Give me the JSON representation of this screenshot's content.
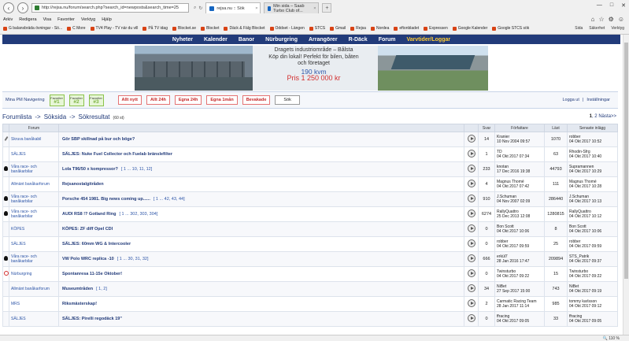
{
  "browser": {
    "url": "http://rejsa.nu/forum/search.php?search_id=newposts&search_time=25",
    "tabs": [
      {
        "title": "rejsa.nu :: Sök",
        "active": true
      },
      {
        "title": "Min sida – Saab Turbo Club of...",
        "active": false
      }
    ],
    "menu": [
      "Arkiv",
      "Redigera",
      "Visa",
      "Favoriter",
      "Verktyg",
      "Hjälp"
    ],
    "favorites": [
      "G balansbräda övningar - Sö...",
      "C More",
      "TV4 Play - TV när du vill",
      "På TV idag",
      "Blocket.se",
      "Blocket",
      "Däck & Fälg Blocket",
      "Oddset - Längen",
      "STCS",
      "Gmail",
      "Rejsa",
      "Nordea",
      "eftonbladet",
      "Expressen",
      "Google Kalender",
      "Google STCS sök"
    ],
    "fav_right": [
      "Sida",
      "Säkerhet",
      "Verktyg"
    ],
    "zoom": "110 %"
  },
  "site": {
    "nav": [
      "Nyheter",
      "Kalender",
      "Banor",
      "Nürburgring",
      "Arrangörer",
      "R-Däck",
      "Forum",
      "Varvtider/Loggar"
    ],
    "nav_highlight_index": 7,
    "banner": {
      "line1": "Dragets industriområde – Bålsta",
      "line2": "Köp din lokal! Perfekt för bilen, båten",
      "line3": "och företaget",
      "size": "190 kvm",
      "price": "Pris 1 250 000 kr"
    }
  },
  "toolbar": {
    "left_links": "Mina PM Navigering",
    "favs": [
      {
        "label": "Favoriter",
        "num": "#1"
      },
      {
        "label": "Favoriter",
        "num": "#2"
      },
      {
        "label": "Favoriter",
        "num": "#3"
      }
    ],
    "buttons": [
      "Allt nytt",
      "Allt 24h",
      "Egna 24h",
      "Egna 1mån",
      "Bevakade"
    ],
    "search_button": "Sök",
    "right": [
      "Logga ut",
      "Inställningar"
    ]
  },
  "breadcrumb": {
    "items": [
      "Forumlista",
      "Söksida",
      "Sökresultat"
    ],
    "separator": "->",
    "count": "(60 st)"
  },
  "pager": {
    "current": "1",
    "other": "2",
    "next": "Nästa>>"
  },
  "table": {
    "headers": {
      "forum": "Forum",
      "svar": "Svar",
      "author": "Författare",
      "last": "Läst",
      "post": "Senaste inlägg"
    },
    "rows": [
      {
        "icon": "pin",
        "forum": "Skruva banåkabil",
        "title": "Gör SBP skillnad på bur och böge?",
        "pages": "",
        "svar": "14",
        "author": "Kranier",
        "author_date": "10 Nov 2004 09:57",
        "last": "1070",
        "post_user": "robber",
        "post_date": "04 Okt 2017 10:52"
      },
      {
        "icon": "none",
        "forum": "SÄLJES",
        "title": "SÄLJES: Nuke Fuel Collector och Fuelab bränslefilter",
        "pages": "",
        "svar": "1",
        "author": "TD",
        "author_date": "04 Okt 2017 07:34",
        "last": "63",
        "post_user": "Rhodin-Sfrg",
        "post_date": "04 Okt 2017 10:40"
      },
      {
        "icon": "blk",
        "forum": "Våra race- och banåkarbilar",
        "title": "Lola T96/50 x kompressor?",
        "pages": "[ 1 ... 10, 11, 12]",
        "svar": "233",
        "author": "knotan",
        "author_date": "17 Dec 2016 19:38",
        "last": "44793",
        "post_user": "Supramannen",
        "post_date": "04 Okt 2017 10:29"
      },
      {
        "icon": "none",
        "forum": "Allmänt banåkarforum",
        "title": "Rejsanostalgitråden",
        "pages": "",
        "svar": "4",
        "author": "Magnus Thomé",
        "author_date": "04 Okt 2017 07:42",
        "last": "111",
        "post_user": "Magnus Thomé",
        "post_date": "04 Okt 2017 10:28"
      },
      {
        "icon": "blk",
        "forum": "Våra race- och banåkarbilar",
        "title": "Porsche 454 1981. Big news coming up......",
        "pages": "[ 1 ... 42, 43, 44]",
        "svar": "910",
        "author": "J.Schuman",
        "author_date": "04 Nov 2007 02:09",
        "last": "286440",
        "post_user": "J.Schuman",
        "post_date": "04 Okt 2017 10:13"
      },
      {
        "icon": "blk",
        "forum": "Våra race- och banåkarbilar",
        "title": "AUDI RS8 !? Gotland Ring",
        "pages": "[ 1 ... 302, 303, 304]",
        "svar": "6274",
        "author": "RallyQuattro",
        "author_date": "25 Dec 2013 12:08",
        "last": "1280815",
        "post_user": "RallyQuattro",
        "post_date": "04 Okt 2017 10:12"
      },
      {
        "icon": "none",
        "forum": "KÖPES",
        "title": "KÖPES: ZF diff Opel CDI",
        "pages": "",
        "svar": "0",
        "author": "Bon Scott",
        "author_date": "04 Okt 2017 10:06",
        "last": "8",
        "post_user": "Bon Scott",
        "post_date": "04 Okt 2017 10:06"
      },
      {
        "icon": "none",
        "forum": "SÄLJES",
        "title": "SÄLJES: 60mm WG & Intercooler",
        "pages": "",
        "svar": "0",
        "author": "robber",
        "author_date": "04 Okt 2017 09:59",
        "last": "25",
        "post_user": "robber",
        "post_date": "04 Okt 2017 09:59"
      },
      {
        "icon": "blk",
        "forum": "Våra race- och banåkarbilar",
        "title": "VW Polo WRC replica -10",
        "pages": "[ 1 ... 30, 31, 32]",
        "svar": "666",
        "author": "erkül7",
        "author_date": "28 Jan 2016 17:47",
        "last": "209894",
        "post_user": "STS_Patrik",
        "post_date": "04 Okt 2017 09:37"
      },
      {
        "icon": "red",
        "forum": "Nürburgring",
        "title": "Spontanresa 11-15e Oktober!",
        "pages": "",
        "svar": "0",
        "author": "Twinsturbo",
        "author_date": "04 Okt 2017 09:22",
        "last": "15",
        "post_user": "Twinsturbo",
        "post_date": "04 Okt 2017 09:22"
      },
      {
        "icon": "none",
        "forum": "Allmänt banåkarforum",
        "title": "Museumtråden",
        "pages": "[ 1, 2]",
        "svar": "34",
        "author": "NiBet",
        "author_date": "27 Sep 2017 15:00",
        "last": "743",
        "post_user": "NiBet",
        "post_date": "04 Okt 2017 09:19"
      },
      {
        "icon": "none",
        "forum": "MRS",
        "title": "Riksmästerskap!",
        "pages": "",
        "svar": "2",
        "author": "Carmatic Racing Team",
        "author_date": "28 Jan 2017 11:14",
        "last": "985",
        "post_user": "tommy karlsson",
        "post_date": "04 Okt 2017 09:12"
      },
      {
        "icon": "none",
        "forum": "SÄLJES",
        "title": "SÄLJES: Pirelli regodäck 19\"",
        "pages": "",
        "svar": "0",
        "author": "ffracing",
        "author_date": "04 Okt 2017 09:05",
        "last": "33",
        "post_user": "ffracing",
        "post_date": "04 Okt 2017 09:05"
      }
    ]
  }
}
